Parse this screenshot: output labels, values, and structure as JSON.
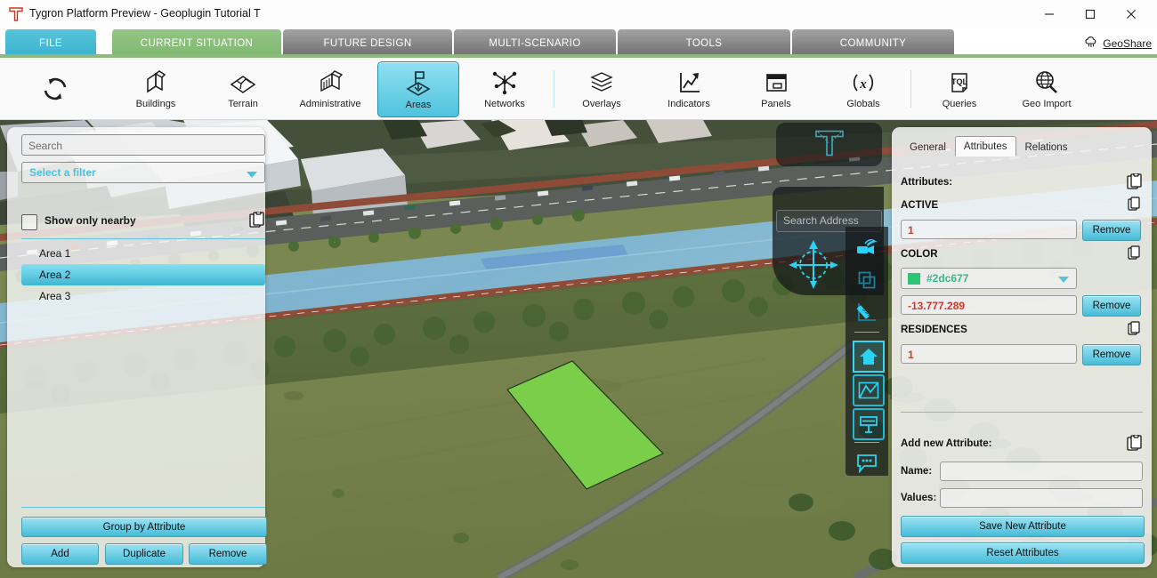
{
  "window": {
    "title": "Tygron Platform Preview - Geoplugin Tutorial T",
    "logo_icon": "tygron-t-logo",
    "minimize_icon": "minimize-icon",
    "maximize_icon": "maximize-icon",
    "close_icon": "close-icon"
  },
  "geoshare": {
    "label": "GeoShare",
    "icon": "cloud-upload-icon"
  },
  "main_tabs": [
    {
      "label": "FILE",
      "state": "accent"
    },
    {
      "label": "CURRENT SITUATION",
      "state": "active"
    },
    {
      "label": "FUTURE DESIGN",
      "state": "inactive"
    },
    {
      "label": "MULTI-SCENARIO",
      "state": "inactive"
    },
    {
      "label": "TOOLS",
      "state": "inactive"
    },
    {
      "label": "COMMUNITY",
      "state": "inactive"
    }
  ],
  "ribbon": {
    "refresh_icon": "refresh-icon",
    "items": [
      {
        "label": "Buildings",
        "icon": "buildings-icon",
        "active": false
      },
      {
        "label": "Terrain",
        "icon": "terrain-icon",
        "active": false
      },
      {
        "label": "Administrative",
        "icon": "administrative-icon",
        "active": false
      },
      {
        "label": "Areas",
        "icon": "areas-flag-icon",
        "active": true
      },
      {
        "label": "Networks",
        "icon": "networks-icon",
        "active": false
      },
      {
        "label": "Overlays",
        "icon": "overlays-layers-icon",
        "active": false
      },
      {
        "label": "Indicators",
        "icon": "indicators-chart-icon",
        "active": false
      },
      {
        "label": "Panels",
        "icon": "panels-window-icon",
        "active": false
      },
      {
        "label": "Globals",
        "icon": "globals-x-icon",
        "active": false
      },
      {
        "label": "Queries",
        "icon": "queries-tql-icon",
        "active": false
      },
      {
        "label": "Geo Import",
        "icon": "geo-import-globe-icon",
        "active": false
      }
    ]
  },
  "left_panel": {
    "search_placeholder": "Search",
    "filter_label": "Select a filter",
    "filter_arrow_icon": "chevron-down-icon",
    "copy_icon": "clipboard-copy-icon",
    "checkbox_label": "Show only nearby",
    "checkbox_checked": false,
    "items": [
      {
        "label": "Area 1",
        "selected": false
      },
      {
        "label": "Area 2",
        "selected": true
      },
      {
        "label": "Area 3",
        "selected": false
      }
    ],
    "group_button": "Group by Attribute",
    "add_button": "Add",
    "duplicate_button": "Duplicate",
    "remove_button": "Remove"
  },
  "right_panel": {
    "tabs": [
      {
        "label": "General",
        "active": false
      },
      {
        "label": "Attributes",
        "active": true
      },
      {
        "label": "Relations",
        "active": false
      }
    ],
    "attributes_label": "Attributes:",
    "copy_icon": "clipboard-copy-icon",
    "attributes": [
      {
        "name": "ACTIVE",
        "value": "1",
        "remove_label": "Remove",
        "type": "text"
      },
      {
        "name": "COLOR",
        "color_hex": "#2dc677",
        "value": "-13.777.289",
        "remove_label": "Remove",
        "type": "color"
      },
      {
        "name": "RESIDENCES",
        "value": "1",
        "remove_label": "Remove",
        "type": "text"
      }
    ],
    "add_new_label": "Add new Attribute:",
    "name_label": "Name:",
    "name_value": "",
    "values_label": "Values:",
    "values_value": "",
    "save_button": "Save New Attribute",
    "reset_button": "Reset Attributes"
  },
  "map_overlay": {
    "top_widget_icon": "tygron-t-outline-icon",
    "compass_icon": "compass-navigation-icon",
    "search_address_placeholder": "Search Address",
    "tools": [
      {
        "icon": "flying-camera-icon",
        "state": "normal"
      },
      {
        "icon": "duplicate-layers-icon",
        "state": "normal"
      },
      {
        "icon": "measure-ruler-icon",
        "state": "normal"
      },
      {
        "icon": "building-home-icon",
        "state": "selected"
      },
      {
        "icon": "terrain-area-icon",
        "state": "boxed"
      },
      {
        "icon": "panel-sign-icon",
        "state": "boxed"
      },
      {
        "icon": "chat-bubble-icon",
        "state": "normal"
      }
    ]
  },
  "colors": {
    "accent_cyan": "#46bcd8",
    "tab_green": "#8cba7d",
    "attribute_color_swatch": "#2dc677",
    "value_red": "#d1392f",
    "selected_area_polygon": "#7bd44a"
  }
}
